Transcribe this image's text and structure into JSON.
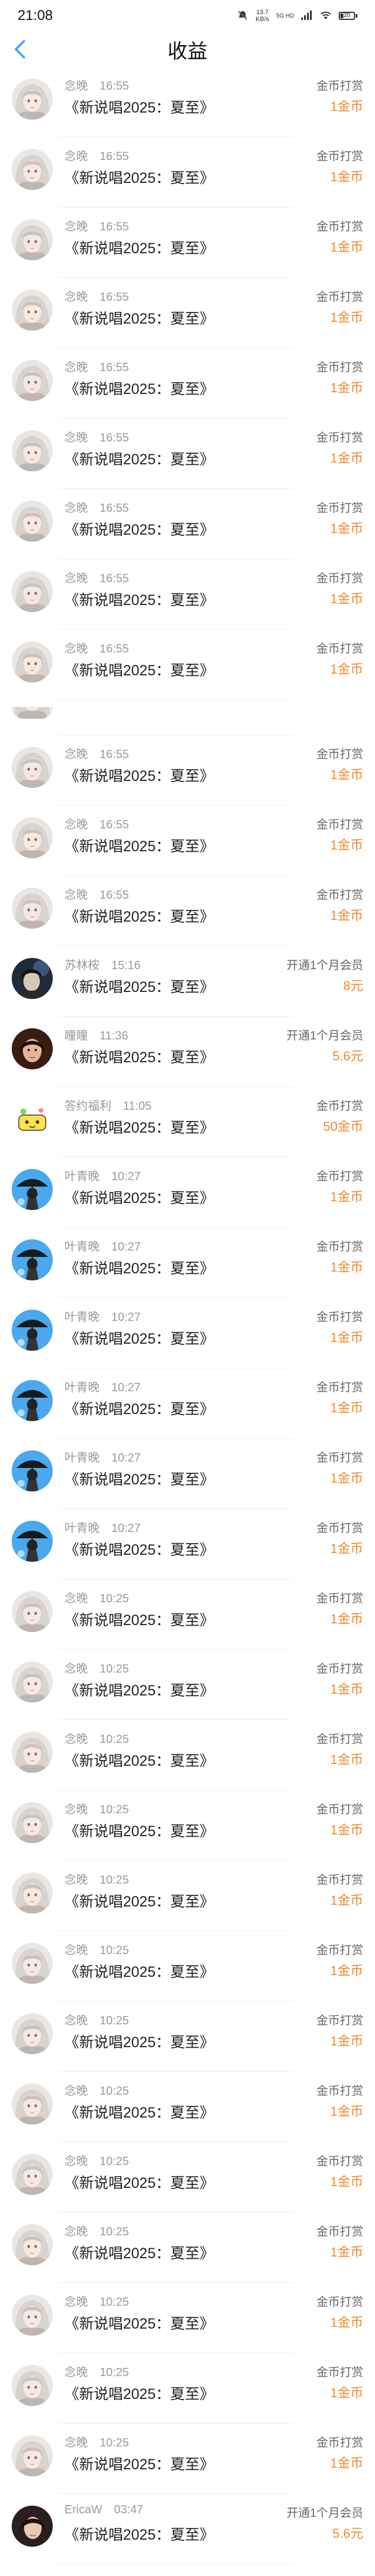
{
  "status": {
    "time": "21:08",
    "net_speed": "13.7",
    "net_unit": "KB/s",
    "net_type": "5G HD",
    "battery": "20"
  },
  "header": {
    "title": "收益"
  },
  "rows": [
    {
      "user": "念晚",
      "time": "16:55",
      "work": "《新说唱2025：夏至》",
      "kind": "金币打赏",
      "amount": "1金币",
      "avatar": "girl"
    },
    {
      "user": "念晚",
      "time": "16:55",
      "work": "《新说唱2025：夏至》",
      "kind": "金币打赏",
      "amount": "1金币",
      "avatar": "girl"
    },
    {
      "user": "念晚",
      "time": "16:55",
      "work": "《新说唱2025：夏至》",
      "kind": "金币打赏",
      "amount": "1金币",
      "avatar": "girl"
    },
    {
      "user": "念晚",
      "time": "16:55",
      "work": "《新说唱2025：夏至》",
      "kind": "金币打赏",
      "amount": "1金币",
      "avatar": "girl"
    },
    {
      "user": "念晚",
      "time": "16:55",
      "work": "《新说唱2025：夏至》",
      "kind": "金币打赏",
      "amount": "1金币",
      "avatar": "girl"
    },
    {
      "user": "念晚",
      "time": "16:55",
      "work": "《新说唱2025：夏至》",
      "kind": "金币打赏",
      "amount": "1金币",
      "avatar": "girl"
    },
    {
      "user": "念晚",
      "time": "16:55",
      "work": "《新说唱2025：夏至》",
      "kind": "金币打赏",
      "amount": "1金币",
      "avatar": "girl"
    },
    {
      "user": "念晚",
      "time": "16:55",
      "work": "《新说唱2025：夏至》",
      "kind": "金币打赏",
      "amount": "1金币",
      "avatar": "girl"
    },
    {
      "user": "念晚",
      "time": "16:55",
      "work": "《新说唱2025：夏至》",
      "kind": "金币打赏",
      "amount": "1金币",
      "avatar": "girl"
    },
    {
      "small": true,
      "avatar": "girl"
    },
    {
      "user": "念晚",
      "time": "16:55",
      "work": "《新说唱2025：夏至》",
      "kind": "金币打赏",
      "amount": "1金币",
      "avatar": "girl"
    },
    {
      "user": "念晚",
      "time": "16:55",
      "work": "《新说唱2025：夏至》",
      "kind": "金币打赏",
      "amount": "1金币",
      "avatar": "girl"
    },
    {
      "user": "念晚",
      "time": "16:55",
      "work": "《新说唱2025：夏至》",
      "kind": "金币打赏",
      "amount": "1金币",
      "avatar": "girl"
    },
    {
      "user": "苏林桉",
      "time": "15:16",
      "work": "《新说唱2025：夏至》",
      "kind": "开通1个月会员",
      "amount": "8元",
      "avatar": "dark"
    },
    {
      "user": "瞳瞳",
      "time": "11:36",
      "work": "《新说唱2025：夏至》",
      "kind": "开通1个月会员",
      "amount": "5.6元",
      "avatar": "portrait"
    },
    {
      "user": "答约福利",
      "time": "11:05",
      "work": "《新说唱2025：夏至》",
      "kind": "金币打赏",
      "amount": "50金币",
      "avatar": "cartoon"
    },
    {
      "user": "叶青晚",
      "time": "10:27",
      "work": "《新说唱2025：夏至》",
      "kind": "金币打赏",
      "amount": "1金币",
      "avatar": "umbrella"
    },
    {
      "user": "叶青晚",
      "time": "10:27",
      "work": "《新说唱2025：夏至》",
      "kind": "金币打赏",
      "amount": "1金币",
      "avatar": "umbrella"
    },
    {
      "user": "叶青晚",
      "time": "10:27",
      "work": "《新说唱2025：夏至》",
      "kind": "金币打赏",
      "amount": "1金币",
      "avatar": "umbrella"
    },
    {
      "user": "叶青晚",
      "time": "10:27",
      "work": "《新说唱2025：夏至》",
      "kind": "金币打赏",
      "amount": "1金币",
      "avatar": "umbrella"
    },
    {
      "user": "叶青晚",
      "time": "10:27",
      "work": "《新说唱2025：夏至》",
      "kind": "金币打赏",
      "amount": "1金币",
      "avatar": "umbrella"
    },
    {
      "user": "叶青晚",
      "time": "10:27",
      "work": "《新说唱2025：夏至》",
      "kind": "金币打赏",
      "amount": "1金币",
      "avatar": "umbrella"
    },
    {
      "user": "念晚",
      "time": "10:25",
      "work": "《新说唱2025：夏至》",
      "kind": "金币打赏",
      "amount": "1金币",
      "avatar": "girl"
    },
    {
      "user": "念晚",
      "time": "10:25",
      "work": "《新说唱2025：夏至》",
      "kind": "金币打赏",
      "amount": "1金币",
      "avatar": "girl"
    },
    {
      "user": "念晚",
      "time": "10:25",
      "work": "《新说唱2025：夏至》",
      "kind": "金币打赏",
      "amount": "1金币",
      "avatar": "girl"
    },
    {
      "user": "念晚",
      "time": "10:25",
      "work": "《新说唱2025：夏至》",
      "kind": "金币打赏",
      "amount": "1金币",
      "avatar": "girl"
    },
    {
      "user": "念晚",
      "time": "10:25",
      "work": "《新说唱2025：夏至》",
      "kind": "金币打赏",
      "amount": "1金币",
      "avatar": "girl"
    },
    {
      "user": "念晚",
      "time": "10:25",
      "work": "《新说唱2025：夏至》",
      "kind": "金币打赏",
      "amount": "1金币",
      "avatar": "girl"
    },
    {
      "user": "念晚",
      "time": "10:25",
      "work": "《新说唱2025：夏至》",
      "kind": "金币打赏",
      "amount": "1金币",
      "avatar": "girl"
    },
    {
      "user": "念晚",
      "time": "10:25",
      "work": "《新说唱2025：夏至》",
      "kind": "金币打赏",
      "amount": "1金币",
      "avatar": "girl"
    },
    {
      "user": "念晚",
      "time": "10:25",
      "work": "《新说唱2025：夏至》",
      "kind": "金币打赏",
      "amount": "1金币",
      "avatar": "girl"
    },
    {
      "user": "念晚",
      "time": "10:25",
      "work": "《新说唱2025：夏至》",
      "kind": "金币打赏",
      "amount": "1金币",
      "avatar": "girl"
    },
    {
      "user": "念晚",
      "time": "10:25",
      "work": "《新说唱2025：夏至》",
      "kind": "金币打赏",
      "amount": "1金币",
      "avatar": "girl"
    },
    {
      "user": "念晚",
      "time": "10:25",
      "work": "《新说唱2025：夏至》",
      "kind": "金币打赏",
      "amount": "1金币",
      "avatar": "girl"
    },
    {
      "user": "念晚",
      "time": "10:25",
      "work": "《新说唱2025：夏至》",
      "kind": "金币打赏",
      "amount": "1金币",
      "avatar": "girl"
    },
    {
      "user": "EricaW",
      "time": "03:47",
      "work": "《新说唱2025：夏至》",
      "kind": "开通1个月会员",
      "amount": "5.6元",
      "avatar": "erica"
    }
  ],
  "colors": {
    "accent_blue": "#3aa0ff",
    "amount_orange": "#f08a30"
  }
}
